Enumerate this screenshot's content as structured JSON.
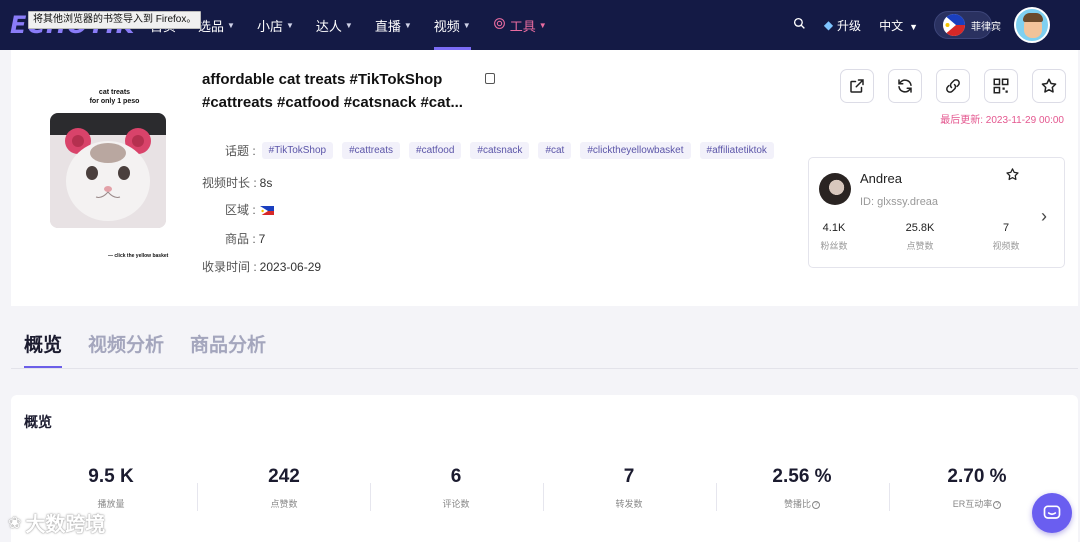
{
  "browser_tooltip": "将其他浏览器的书签导入到 Firefox。",
  "logo_text": "ECHOTIK",
  "nav": {
    "items": [
      {
        "label": "首页",
        "active": false,
        "has_chevron": false
      },
      {
        "label": "选品",
        "active": false,
        "has_chevron": true
      },
      {
        "label": "小店",
        "active": false,
        "has_chevron": true
      },
      {
        "label": "达人",
        "active": false,
        "has_chevron": true
      },
      {
        "label": "直播",
        "active": false,
        "has_chevron": true
      },
      {
        "label": "视频",
        "active": true,
        "has_chevron": true
      }
    ],
    "tools_label": "工具",
    "upgrade_label": "升级",
    "language": "中文",
    "region": "菲律宾"
  },
  "video": {
    "title_line1": "affordable cat treats #TikTokShop",
    "title_line2": "#cattreats #catfood #catsnack #cat...",
    "thumb_text_top1": "cat treats",
    "thumb_text_top2": "for only 1 peso",
    "thumb_text_bottom": "— click the yellow basket",
    "topics_label": "话题 :",
    "topics": [
      "#TikTokShop",
      "#cattreats",
      "#catfood",
      "#catsnack",
      "#cat",
      "#clicktheyellowbasket",
      "#affiliatetiktok"
    ],
    "duration_label": "视频时长 :",
    "duration": "8s",
    "region_label": "区域 :",
    "products_label": "商品 :",
    "products": "7",
    "collected_label": "收录时间 :",
    "collected": "2023-06-29",
    "updated": "最后更新: 2023-11-29 00:00"
  },
  "author": {
    "name": "Andrea",
    "id": "ID: glxssy.dreaa",
    "stats": [
      {
        "value": "4.1K",
        "label": "粉丝数"
      },
      {
        "value": "25.8K",
        "label": "点赞数"
      },
      {
        "value": "7",
        "label": "视频数"
      }
    ]
  },
  "tabs": [
    {
      "label": "概览",
      "active": true
    },
    {
      "label": "视频分析",
      "active": false
    },
    {
      "label": "商品分析",
      "active": false
    }
  ],
  "overview": {
    "title": "概览",
    "metrics": [
      {
        "value": "9.5 K",
        "label": "播放量",
        "help": false
      },
      {
        "value": "242",
        "label": "点赞数",
        "help": false
      },
      {
        "value": "6",
        "label": "评论数",
        "help": false
      },
      {
        "value": "7",
        "label": "转发数",
        "help": false
      },
      {
        "value": "2.56 %",
        "label": "赞播比",
        "help": true
      },
      {
        "value": "2.70 %",
        "label": "ER互动率",
        "help": true
      }
    ]
  },
  "watermark": "大数跨境",
  "colors": {
    "nav_bg": "#141a45",
    "accent": "#6b5ee8",
    "updated_text": "#e4578f",
    "tag_bg": "#f2f1fa"
  }
}
